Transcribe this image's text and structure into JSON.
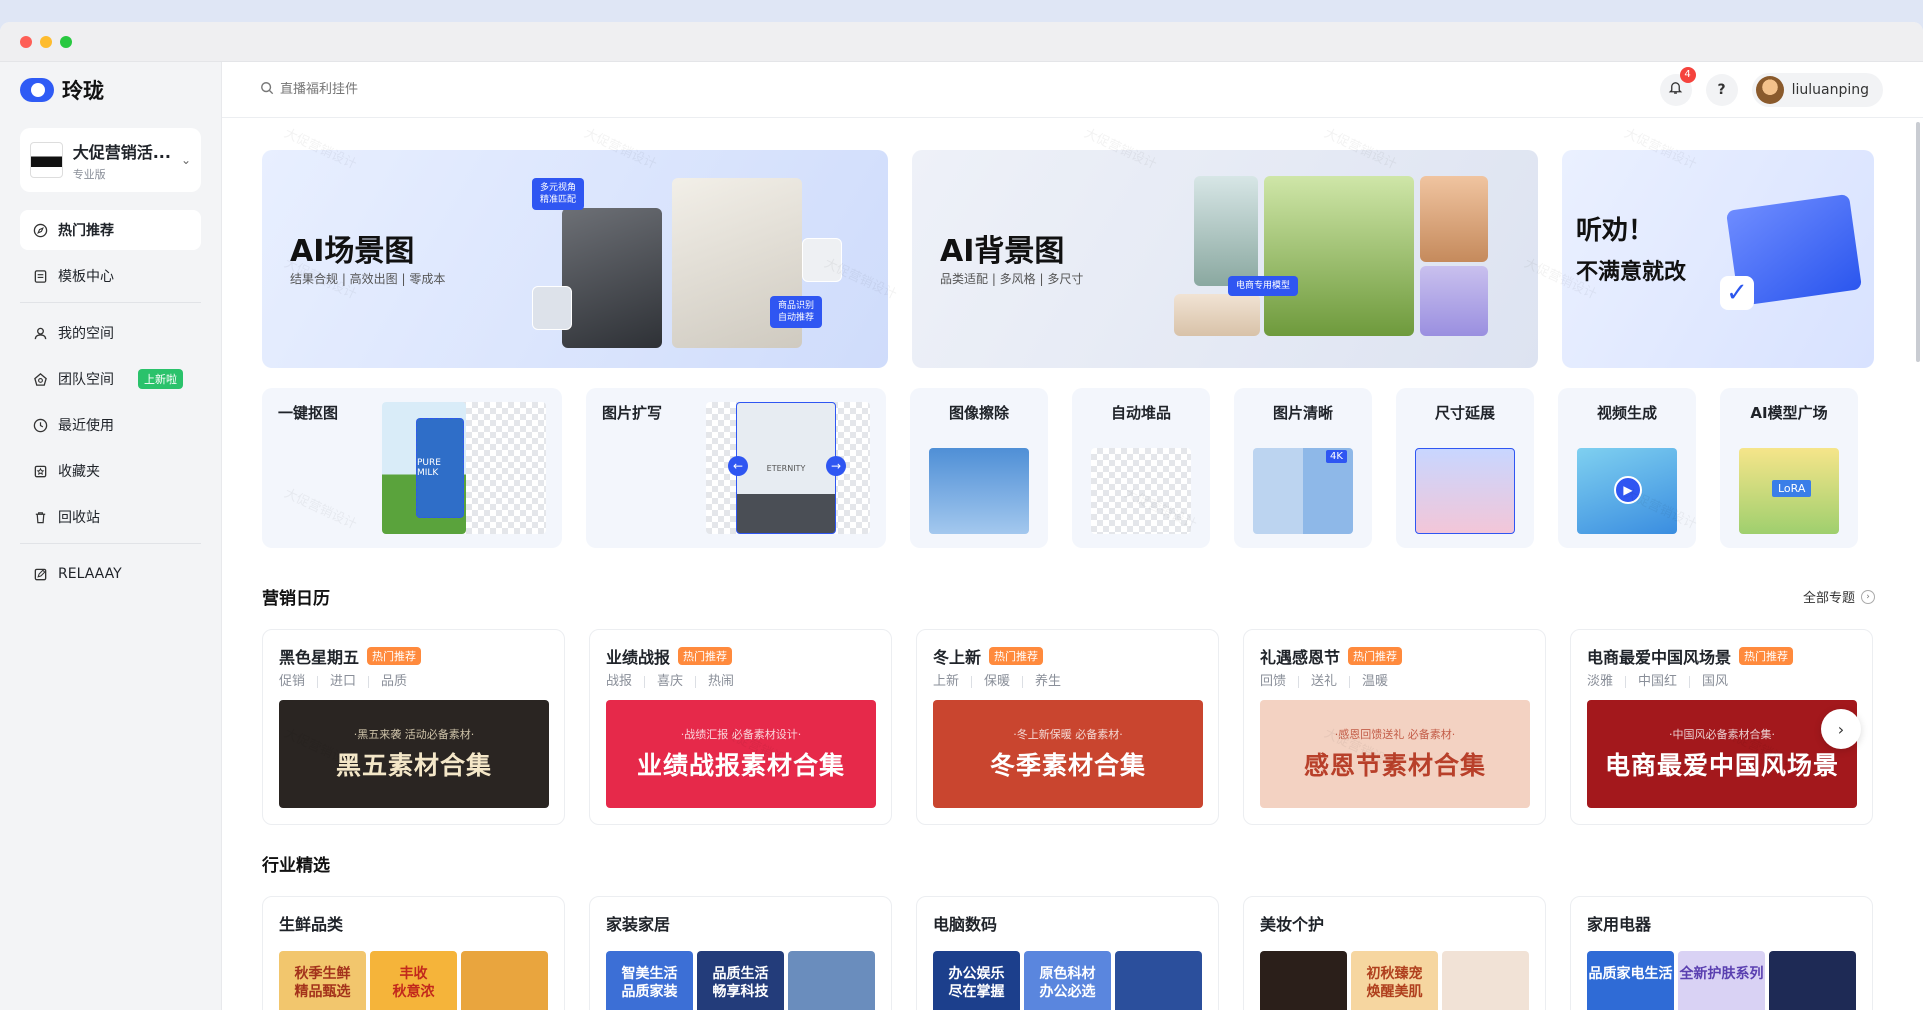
{
  "app": {
    "name": "玲珑"
  },
  "workspace": {
    "name": "大促营销活...",
    "plan": "专业版"
  },
  "sidebar": {
    "items": [
      {
        "label": "热门推荐",
        "icon": "compass-icon"
      },
      {
        "label": "模板中心",
        "icon": "template-icon"
      },
      {
        "label": "我的空间",
        "icon": "user-icon"
      },
      {
        "label": "团队空间",
        "icon": "team-icon",
        "badge": "上新啦"
      },
      {
        "label": "最近使用",
        "icon": "clock-icon"
      },
      {
        "label": "收藏夹",
        "icon": "bookmark-icon"
      },
      {
        "label": "回收站",
        "icon": "trash-icon"
      },
      {
        "label": "RELAAAY",
        "icon": "edit-icon"
      }
    ]
  },
  "topbar": {
    "search_placeholder": "直播福利挂件",
    "notification_count": "4",
    "help_label": "?",
    "username": "liuluanping"
  },
  "banners": [
    {
      "title": "AI场景图",
      "subtitle": "结果合规 | 高效出图 | 零成本",
      "tag1": "多元视角\n精准匹配",
      "tag2": "商品识别\n自动推荐"
    },
    {
      "title": "AI背景图",
      "subtitle": "品类适配 | 多风格 | 多尺寸",
      "tag": "电商专用模型"
    },
    {
      "line1": "听劝！",
      "line2": "不满意就改"
    }
  ],
  "tools": [
    {
      "label": "一键抠图",
      "image_text": "PURE MILK"
    },
    {
      "label": "图片扩写",
      "image_text": "ETERNITY"
    },
    {
      "label": "图像擦除"
    },
    {
      "label": "自动堆品"
    },
    {
      "label": "图片清晰",
      "badge": "4K"
    },
    {
      "label": "尺寸延展"
    },
    {
      "label": "视频生成"
    },
    {
      "label": "AI模型广场",
      "badge": "LoRA"
    }
  ],
  "calendar": {
    "title": "营销日历",
    "more": "全部专题",
    "cards": [
      {
        "name": "黑色星期五",
        "hot": "热门推荐",
        "tags": [
          "促销",
          "进口",
          "品质"
        ],
        "kicker": "·黑五来袭 活动必备素材·",
        "headline": "黑五素材合集",
        "bg": "#2a2522",
        "fg": "#f4e7c8"
      },
      {
        "name": "业绩战报",
        "hot": "热门推荐",
        "tags": [
          "战报",
          "喜庆",
          "热闹"
        ],
        "kicker": "·战绩汇报 必备素材设计·",
        "headline": "业绩战报素材合集",
        "bg": "#e6294a",
        "fg": "#ffffff"
      },
      {
        "name": "冬上新",
        "hot": "热门推荐",
        "tags": [
          "上新",
          "保暖",
          "养生"
        ],
        "kicker": "·冬上新保暖 必备素材·",
        "headline": "冬季素材合集",
        "bg": "#c9452f",
        "fg": "#ffffff"
      },
      {
        "name": "礼遇感恩节",
        "hot": "热门推荐",
        "tags": [
          "回馈",
          "送礼",
          "温暖"
        ],
        "kicker": "·感恩回馈送礼 必备素材·",
        "headline": "感恩节素材合集",
        "bg": "#f3d2c2",
        "fg": "#b8402a"
      },
      {
        "name": "电商最爱中国风场景",
        "hot": "热门推荐",
        "tags": [
          "淡雅",
          "中国红",
          "国风"
        ],
        "kicker": "·中国风必备素材合集·",
        "headline": "电商最爱中国风场景",
        "bg": "#a3181c",
        "fg": "#ffffff"
      }
    ]
  },
  "industry": {
    "title": "行业精选",
    "cards": [
      {
        "name": "生鲜品类",
        "thumbs": [
          {
            "text": "秋季生鲜\n精品甄选",
            "bg": "#f2c66d",
            "fg": "#a3321b"
          },
          {
            "text": "丰收\n秋意浓",
            "bg": "#f5b43a",
            "fg": "#c2281c"
          },
          {
            "text": "",
            "bg": "#e9a53e",
            "fg": "#ffffff"
          }
        ]
      },
      {
        "name": "家装家居",
        "thumbs": [
          {
            "text": "智美生活\n品质家装",
            "bg": "#3c6fd6",
            "fg": "#ffffff"
          },
          {
            "text": "品质生活\n畅享科技",
            "bg": "#233c7a",
            "fg": "#ffffff"
          },
          {
            "text": "",
            "bg": "#6a8dbd",
            "fg": "#ffffff"
          }
        ]
      },
      {
        "name": "电脑数码",
        "thumbs": [
          {
            "text": "办公娱乐\n尽在掌握",
            "bg": "#1c3f8c",
            "fg": "#ffffff"
          },
          {
            "text": "原色科材\n办公必选",
            "bg": "#5a86de",
            "fg": "#ffffff"
          },
          {
            "text": "",
            "bg": "#2b4f9c",
            "fg": "#ffffff"
          }
        ]
      },
      {
        "name": "美妆个护",
        "thumbs": [
          {
            "text": "",
            "bg": "#2b1f1a",
            "fg": "#f0d9b0"
          },
          {
            "text": "初秋臻宠\n焕醒美肌",
            "bg": "#f6d6a0",
            "fg": "#b0401e"
          },
          {
            "text": "",
            "bg": "#f1e2d6",
            "fg": "#333333"
          }
        ]
      },
      {
        "name": "家用电器",
        "thumbs": [
          {
            "text": "品质家电生活",
            "bg": "#2f6bd6",
            "fg": "#ffffff"
          },
          {
            "text": "全新护肤系列",
            "bg": "#d9d2f4",
            "fg": "#5a3fb0"
          },
          {
            "text": "",
            "bg": "#1e2a55",
            "fg": "#ffffff"
          }
        ]
      }
    ]
  },
  "watermark": "大促营销设计"
}
